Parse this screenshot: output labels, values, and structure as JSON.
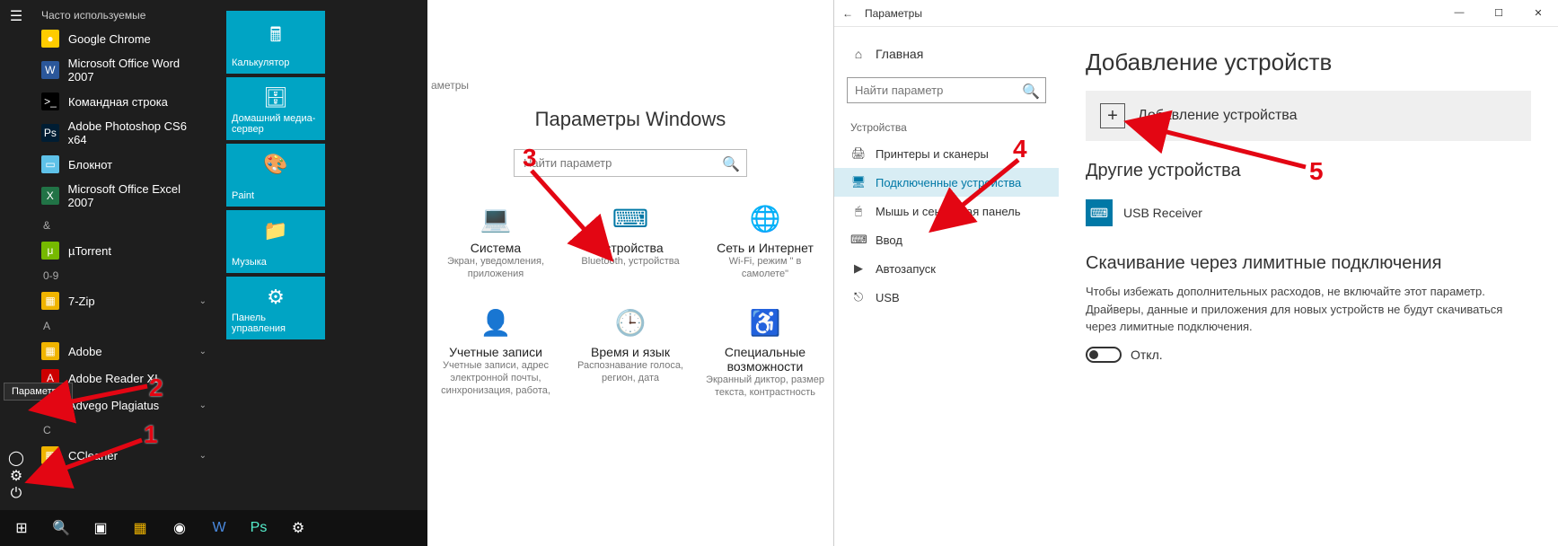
{
  "panel1": {
    "tooltip": "Параметры",
    "freq_header": "Часто используемые",
    "apps": [
      {
        "label": "Google Chrome",
        "bg": "#ffcc00",
        "sym": "●"
      },
      {
        "label": "Microsoft Office Word 2007",
        "bg": "#2b579a",
        "sym": "W"
      },
      {
        "label": "Командная строка",
        "bg": "#000",
        "sym": ">_"
      },
      {
        "label": "Adobe Photoshop CS6 x64",
        "bg": "#001d33",
        "sym": "Ps"
      },
      {
        "label": "Блокнот",
        "bg": "#5ec1e8",
        "sym": "▭"
      },
      {
        "label": "Microsoft Office Excel 2007",
        "bg": "#217346",
        "sym": "X"
      }
    ],
    "letters": [
      {
        "h": "&",
        "items": [
          {
            "label": "µTorrent",
            "bg": "#76b900",
            "sym": "μ"
          }
        ]
      },
      {
        "h": "0-9",
        "items": [
          {
            "label": "7-Zip",
            "bg": "#f0b400",
            "sym": "▦",
            "chev": true
          }
        ]
      },
      {
        "h": "A",
        "items": [
          {
            "label": "Adobe",
            "bg": "#f0b400",
            "sym": "▦",
            "chev": true
          },
          {
            "label": "Adobe Reader XI",
            "bg": "#c00",
            "sym": "A"
          },
          {
            "label": "Advego Plagiatus",
            "bg": "#f0b400",
            "sym": "▦",
            "chev": true
          }
        ]
      },
      {
        "h": "C",
        "items": [
          {
            "label": "CCleaner",
            "bg": "#f0b400",
            "sym": "▦",
            "chev": true
          }
        ]
      }
    ],
    "tiles": [
      {
        "label": "Калькулятор",
        "sym": "🖩"
      },
      {
        "label": "Домашний медиа-сервер",
        "sym": "🗄"
      },
      {
        "label": "Paint",
        "sym": "🎨"
      },
      {
        "label": "Музыка",
        "sym": "📁"
      },
      {
        "label": "Панель управления",
        "sym": "⚙"
      }
    ]
  },
  "panel2": {
    "breadcrumb": "аметры",
    "title": "Параметры Windows",
    "search_ph": "Найти параметр",
    "cards": [
      {
        "t": "Система",
        "s": "Экран, уведомления, приложения",
        "ic": "💻"
      },
      {
        "t": "Устройства",
        "s": "Bluetooth, устройства",
        "ic": "⌨"
      },
      {
        "t": "Сеть и Интернет",
        "s": "Wi-Fi, режим \" в самолете\"",
        "ic": "🌐"
      },
      {
        "t": "Учетные записи",
        "s": "Учетные записи, адрес электронной почты, синхронизация, работа,",
        "ic": "👤"
      },
      {
        "t": "Время и язык",
        "s": "Распознавание голоса, регион, дата",
        "ic": "🕒"
      },
      {
        "t": "Специальные возможности",
        "s": "Экранный диктор, размер текста, контрастность",
        "ic": "♿"
      }
    ]
  },
  "panel3": {
    "window_title": "Параметры",
    "home": "Главная",
    "search_ph": "Найти параметр",
    "section": "Устройства",
    "navitems": [
      {
        "label": "Принтеры и сканеры",
        "ic": "🖨"
      },
      {
        "label": "Подключенные устройства",
        "ic": "🖥",
        "active": true
      },
      {
        "label": "Мышь и сенсорная панель",
        "ic": "🖱"
      },
      {
        "label": "Ввод",
        "ic": "⌨"
      },
      {
        "label": "Автозапуск",
        "ic": "▶"
      },
      {
        "label": "USB",
        "ic": "⎋"
      }
    ],
    "h_add": "Добавление устройств",
    "add_btn": "Добавление устройства",
    "h_other": "Другие устройства",
    "device": "USB Receiver",
    "h_limit": "Скачивание через лимитные подключения",
    "note": "Чтобы избежать дополнительных расходов, не включайте этот параметр. Драйверы, данные и приложения для новых устройств не будут скачиваться через лимитные подключения.",
    "toggle_label": "Откл."
  },
  "callouts": {
    "n1": "1",
    "n2": "2",
    "n3": "3",
    "n4": "4",
    "n5": "5"
  }
}
